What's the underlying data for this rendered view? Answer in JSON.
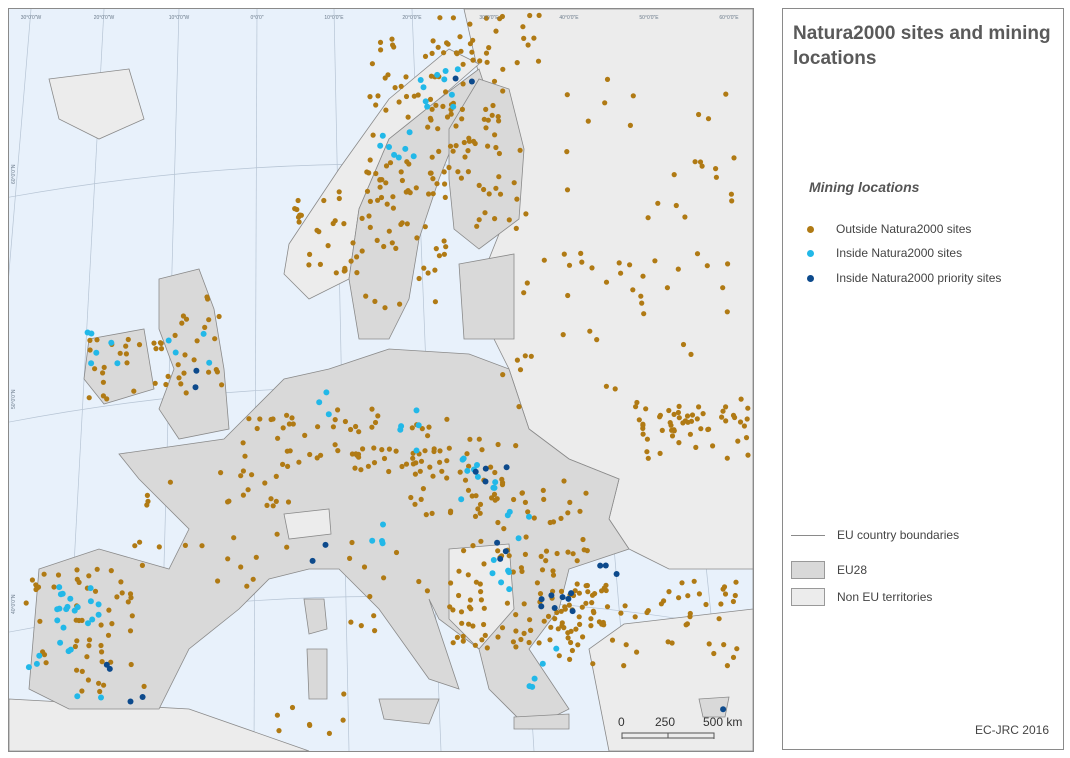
{
  "map": {
    "graticule_labels": [
      "30°0'0\"W",
      "20°0'0\"W",
      "10°0'0\"W",
      "0°0'0\"",
      "10°0'0\"E",
      "20°0'0\"E",
      "30°0'0\"E",
      "40°0'0\"E",
      "50°0'0\"E",
      "60°0'0\"E"
    ],
    "lat_labels": [
      "60°0'0\"N",
      "50°0'0\"N",
      "40°0'0\"N"
    ],
    "scale_ticks": [
      "0",
      "250",
      "500 km"
    ],
    "colors": {
      "sea": "#e8f1fb",
      "eu28": "#d9d9d9",
      "non_eu": "#ececec",
      "outside": "#b07a14",
      "inside": "#22b8e8",
      "priority": "#0d4a8c",
      "boundary": "#8a8a8a"
    },
    "mining_counts_note": "points shown as scattered markers"
  },
  "legend": {
    "title": "Natura2000 sites and mining locations",
    "mining_heading": "Mining locations",
    "items": [
      {
        "label": "Outside Natura2000 sites",
        "color": "#b07a14"
      },
      {
        "label": "Inside Natura2000 sites",
        "color": "#22b8e8"
      },
      {
        "label": "Inside Natura2000 priority sites",
        "color": "#0d4a8c"
      }
    ],
    "boundary_label": "EU country boundaries",
    "eu28_label": "EU28",
    "non_eu_label": "Non EU territories",
    "credit": "EC-JRC 2016"
  }
}
